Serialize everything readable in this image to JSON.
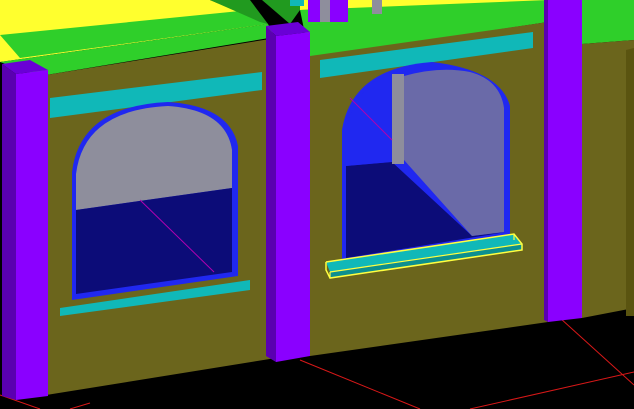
{
  "viewport": {
    "background": "#000000",
    "colors": {
      "wall": "#6b651c",
      "wall_shadow": "#5a5410",
      "roof": "#ffff2e",
      "roof_trim": "#2fcf2a",
      "roof_trim_dark": "#219a1f",
      "sill_cyan": "#10b8b8",
      "sill_cyan_dark": "#0c8f8f",
      "pillar": "#8a00ff",
      "pillar_dark": "#5a00b0",
      "pillar_top": "#6a00d6",
      "window_frame": "#2028f0",
      "window_glass_sky": "#8e8e9c",
      "window_glass_floor": "#0c0c78",
      "interior_light": "#6a6aa8",
      "ground_line": "#d81818",
      "selection": "#ffff40",
      "diagonal": "#b000b0"
    }
  }
}
